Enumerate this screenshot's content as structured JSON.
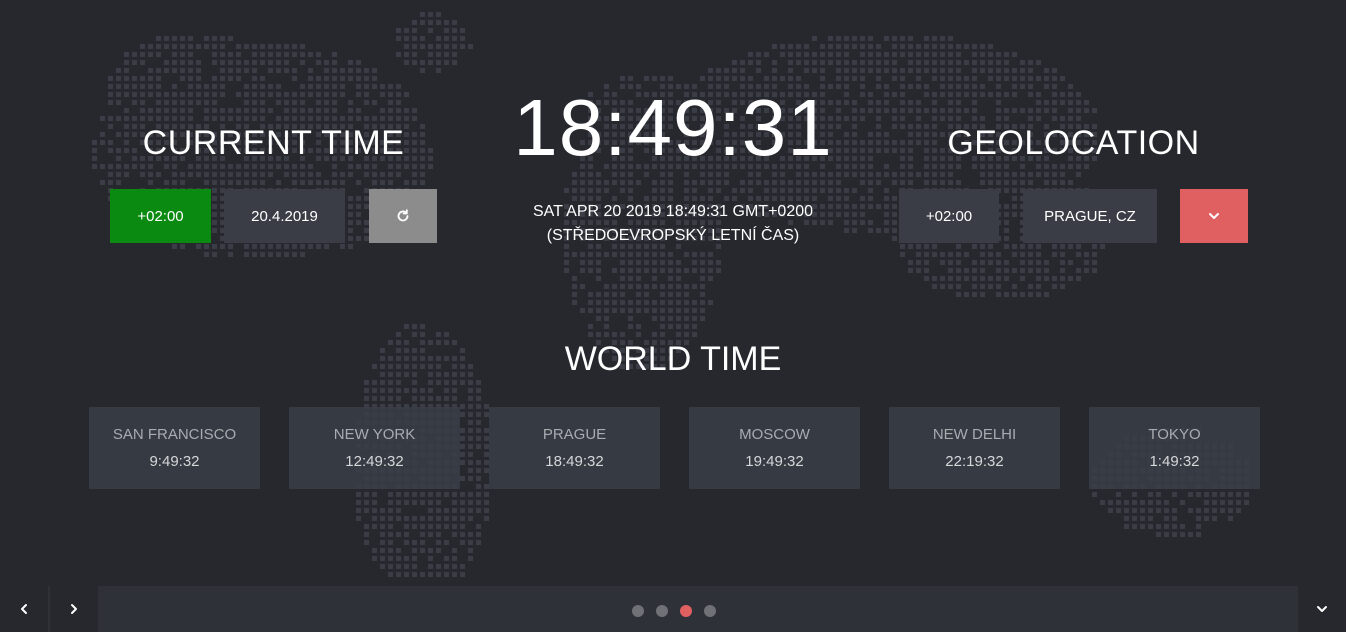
{
  "current_time": {
    "title": "CURRENT TIME",
    "offset": "+02:00",
    "date": "20.4.2019",
    "refresh_icon": "refresh-icon"
  },
  "clock": {
    "time": "18:49:31",
    "full_date_line1": "SAT APR 20 2019 18:49:31 GMT+0200",
    "full_date_line2": "(STŘEDOEVROPSKÝ LETNÍ ČAS)"
  },
  "geolocation": {
    "title": "GEOLOCATION",
    "offset": "+02:00",
    "location": "PRAGUE, CZ",
    "dropdown_icon": "chevron-down-icon"
  },
  "world_time": {
    "title": "WORLD TIME",
    "cities": [
      {
        "name": "SAN FRANCISCO",
        "time": "9:49:32"
      },
      {
        "name": "NEW YORK",
        "time": "12:49:32"
      },
      {
        "name": "PRAGUE",
        "time": "18:49:32"
      },
      {
        "name": "MOSCOW",
        "time": "19:49:32"
      },
      {
        "name": "NEW DELHI",
        "time": "22:19:32"
      },
      {
        "name": "TOKYO",
        "time": "1:49:32"
      }
    ]
  },
  "footer": {
    "pagination": {
      "count": 4,
      "active_index": 2
    },
    "icons": {
      "prev": "chevron-left-icon",
      "next": "chevron-right-icon",
      "expand": "chevron-down-icon"
    }
  },
  "colors": {
    "background": "#26282e",
    "panel": "#3a3d45",
    "green": "#0b8a12",
    "grey": "#8c8c8c",
    "accent_red": "#e06062"
  }
}
